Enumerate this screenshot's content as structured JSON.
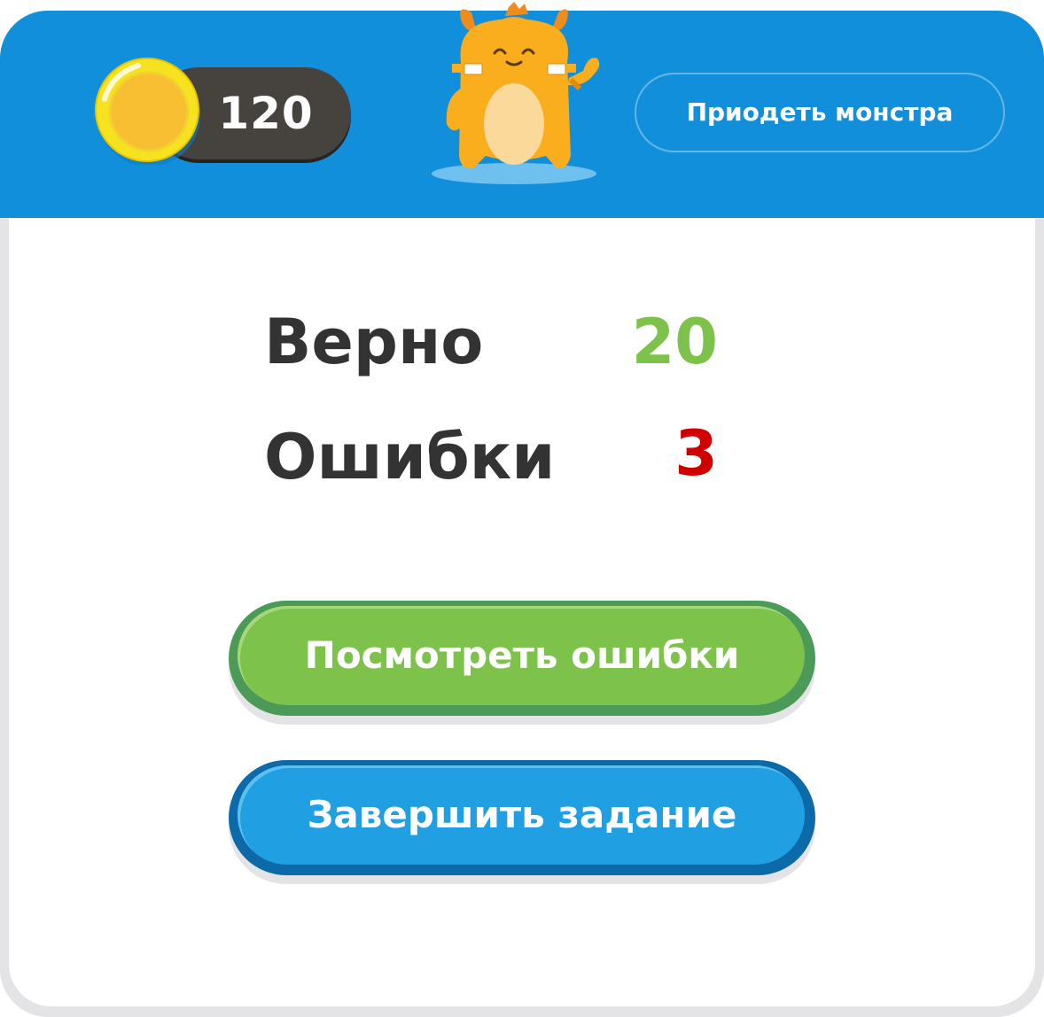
{
  "header": {
    "coins": "120",
    "dress_button_label": "Приодеть монстра"
  },
  "stats": {
    "correct_label": "Верно",
    "correct_value": "20",
    "errors_label": "Ошибки",
    "errors_value": "3"
  },
  "actions": {
    "review_label": "Посмотреть ошибки",
    "finish_label": "Завершить задание"
  },
  "colors": {
    "header": "#118fdb",
    "correct": "#7dc24a",
    "errors": "#d10000",
    "green_button": "#7dc24a",
    "blue_button": "#20a0e2"
  },
  "icons": [
    "coin-icon",
    "monster-mascot"
  ]
}
